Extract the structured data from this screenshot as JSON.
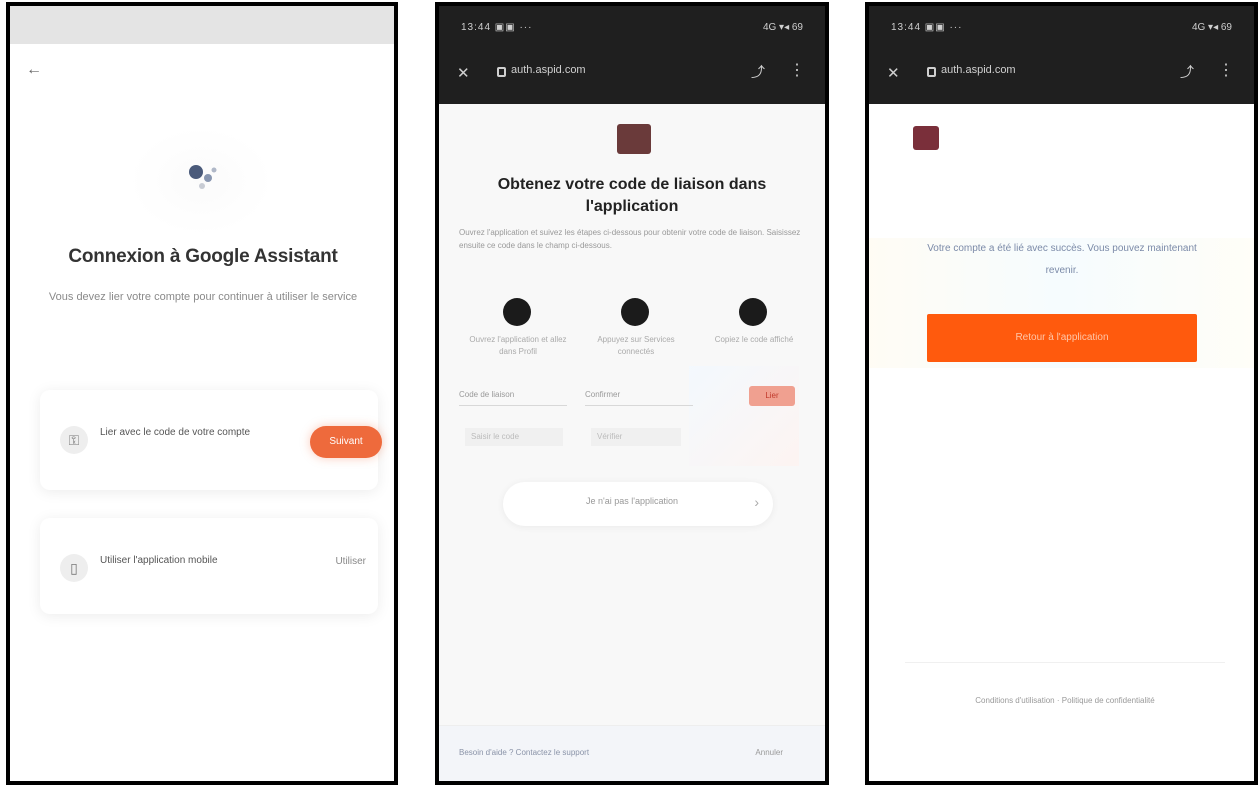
{
  "screen1": {
    "back_icon": "←",
    "title": "Connexion à Google Assistant",
    "subtitle": "Vous devez lier votre compte pour continuer à utiliser le service",
    "option_1": {
      "text": "Lier avec le code de votre compte",
      "button": "Suivant"
    },
    "option_2": {
      "text": "Utiliser l'application mobile",
      "button": "Utiliser"
    }
  },
  "screen2": {
    "status_left": "13:44 ▣▣ ···",
    "status_right": "4G ▾◂ 69",
    "close_icon": "✕",
    "url": "auth.aspid.com",
    "share_icon": "⤴",
    "more_icon": "⋮",
    "title": "Obtenez votre code de liaison dans l'application",
    "description": "Ouvrez l'application et suivez les étapes ci-dessous pour obtenir votre code de liaison. Saisissez ensuite ce code dans le champ ci-dessous.",
    "steps": [
      {
        "text": "Ouvrez l'application et allez dans Profil"
      },
      {
        "text": "Appuyez sur Services connectés"
      },
      {
        "text": "Copiez le code affiché"
      }
    ],
    "fields": [
      {
        "placeholder": "Code de liaison"
      },
      {
        "placeholder": "Confirmer"
      }
    ],
    "submit": "Lier",
    "hints": [
      "Saisir le code",
      "Vérifier"
    ],
    "pill_text": "Je n'ai pas l'application",
    "pill_arrow": "›",
    "footer_left": "Besoin d'aide ? Contactez le support",
    "footer_right": "Annuler"
  },
  "screen3": {
    "status_left": "13:44 ▣▣ ···",
    "status_right": "4G ▾◂ 69",
    "close_icon": "✕",
    "url": "auth.aspid.com",
    "share_icon": "⤴",
    "more_icon": "⋮",
    "message": "Votre compte a été lié avec succès. Vous pouvez maintenant revenir.",
    "button": "Retour à l'application",
    "footer": "Conditions d'utilisation · Politique de confidentialité"
  },
  "colors": {
    "accent_orange": "#ff5a0d",
    "button_orange": "#ee6a3c",
    "dark_header": "#1f1f1f"
  }
}
